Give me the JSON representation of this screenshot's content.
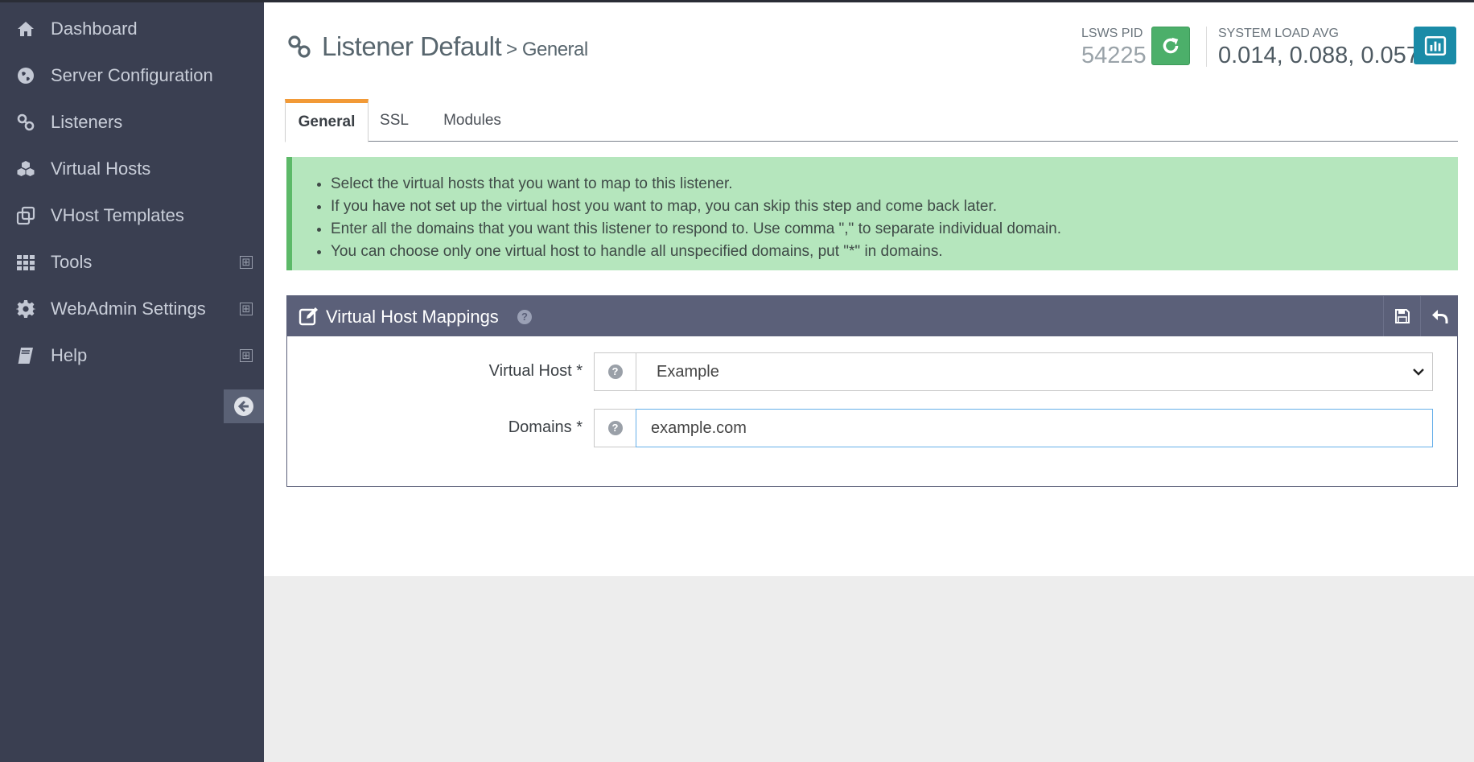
{
  "sidebar": {
    "items": [
      {
        "label": "Dashboard",
        "icon": "home-icon",
        "expandable": false
      },
      {
        "label": "Server Configuration",
        "icon": "globe-icon",
        "expandable": false
      },
      {
        "label": "Listeners",
        "icon": "link-icon",
        "expandable": false
      },
      {
        "label": "Virtual Hosts",
        "icon": "cubes-icon",
        "expandable": false
      },
      {
        "label": "VHost Templates",
        "icon": "clone-icon",
        "expandable": false
      },
      {
        "label": "Tools",
        "icon": "grid-icon",
        "expandable": true,
        "expand_symbol": "⊞"
      },
      {
        "label": "WebAdmin Settings",
        "icon": "gear-icon",
        "expandable": true,
        "expand_symbol": "⊞"
      },
      {
        "label": "Help",
        "icon": "book-icon",
        "expandable": true,
        "expand_symbol": "⊞"
      }
    ]
  },
  "header": {
    "title": "Listener Default",
    "subtitle": "> General",
    "title_icon": "link-icon"
  },
  "stats": {
    "pid_label": "LSWS PID",
    "pid_value": "54225",
    "load_label": "SYSTEM LOAD AVG",
    "load_value": "0.014, 0.088, 0.057"
  },
  "tabs": [
    {
      "label": "General",
      "active": true
    },
    {
      "label": "SSL",
      "active": false
    },
    {
      "label": "Modules",
      "active": false
    }
  ],
  "info": {
    "items": [
      "Select the virtual hosts that you want to map to this listener.",
      "If you have not set up the virtual host you want to map, you can skip this step and come back later.",
      "Enter all the domains that you want this listener to respond to. Use comma \",\" to separate individual domain.",
      "You can choose only one virtual host to handle all unspecified domains, put \"*\" in domains."
    ]
  },
  "panel": {
    "title": "Virtual Host Mappings",
    "help_symbol": "?",
    "fields": {
      "virtual_host": {
        "label": "Virtual Host *",
        "value": "Example",
        "help": "?"
      },
      "domains": {
        "label": "Domains *",
        "value": "example.com",
        "help": "?"
      }
    }
  },
  "colors": {
    "sidebar_bg": "#3a3f51",
    "panel_header": "#5b6079",
    "info_bg": "#b5e6bd",
    "info_border": "#5cb968",
    "tab_accent": "#f29a37",
    "refresh_btn": "#4caf6a",
    "chart_btn": "#1a8ba7"
  }
}
